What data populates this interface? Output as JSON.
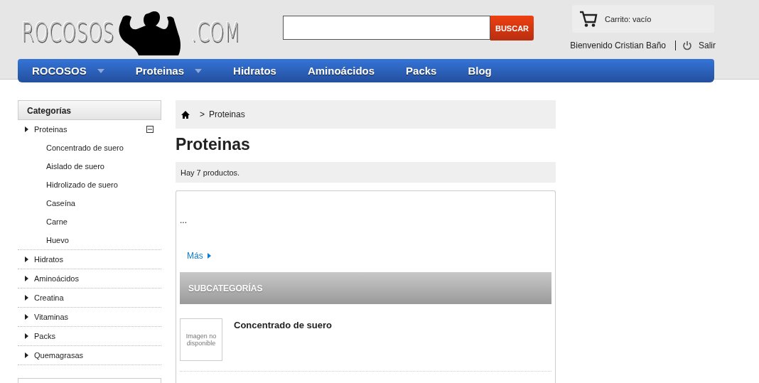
{
  "logo": {
    "left": "ROCOSOS",
    "right": ".COM"
  },
  "search": {
    "button": "BUSCAR"
  },
  "cart": {
    "label": "Carrito: vacío"
  },
  "user": {
    "welcome": "Bienvenido Cristian Baño",
    "logout": "Salir"
  },
  "nav": [
    {
      "label": "ROCOSOS",
      "has_menu": true
    },
    {
      "label": "Proteinas",
      "has_menu": true
    },
    {
      "label": "Hidratos",
      "has_menu": false
    },
    {
      "label": "Aminoácidos",
      "has_menu": false
    },
    {
      "label": "Packs",
      "has_menu": false
    },
    {
      "label": "Blog",
      "has_menu": false
    }
  ],
  "sidebar": {
    "title": "Categorías",
    "items": [
      {
        "label": "Proteinas",
        "expanded": true,
        "children": [
          {
            "label": "Concentrado de suero"
          },
          {
            "label": "Aislado de suero"
          },
          {
            "label": "Hidrolizado de suero"
          },
          {
            "label": "Caseína"
          },
          {
            "label": "Carne"
          },
          {
            "label": "Huevo"
          }
        ]
      },
      {
        "label": "Hidratos",
        "expanded": false
      },
      {
        "label": "Aminoácidos",
        "expanded": false
      },
      {
        "label": "Creatina",
        "expanded": false
      },
      {
        "label": "Vitaminas",
        "expanded": false
      },
      {
        "label": "Packs",
        "expanded": false
      },
      {
        "label": "Quemagrasas",
        "expanded": false
      }
    ]
  },
  "breadcrumb": {
    "separator": ">",
    "current": "Proteinas"
  },
  "page_title": "Proteinas",
  "product_count": "Hay 7 productos.",
  "description": "...",
  "more_link": "Más",
  "subcategories": {
    "heading": "SUBCATEGORÍAS",
    "items": [
      {
        "image_text": "Imagen no disponible",
        "name": "Concentrado de suero"
      }
    ]
  }
}
